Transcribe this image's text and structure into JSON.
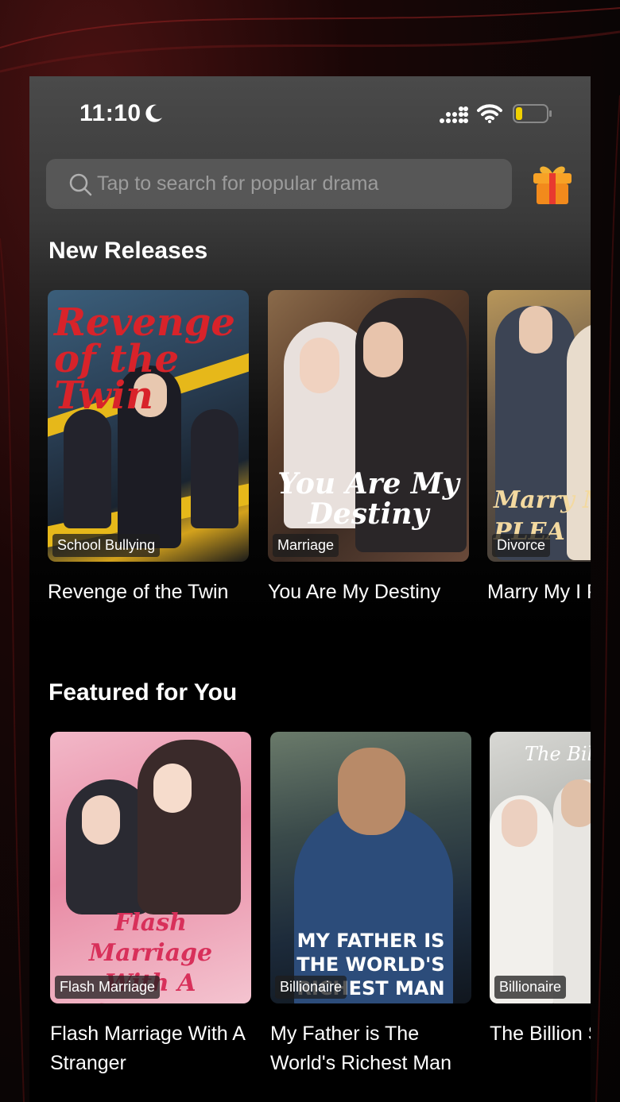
{
  "status": {
    "time": "11:10"
  },
  "search": {
    "placeholder": "Tap to search for popular drama"
  },
  "sections": [
    {
      "title": "New Releases",
      "items": [
        {
          "title": "Revenge of the Twin",
          "tag": "School Bullying",
          "poster_text": "Revenge of the Twin"
        },
        {
          "title": "You Are My Destiny",
          "tag": "Marriage",
          "poster_text": "You Are My Destiny"
        },
        {
          "title": "Marry My I Please!",
          "tag": "Divorce",
          "poster_text": "Marry M PLEA"
        }
      ]
    },
    {
      "title": "Featured for You",
      "items": [
        {
          "title": "Flash Marriage With A Stranger",
          "tag": "Flash Marriage",
          "poster_text": "Flash Marriage With A Stranger"
        },
        {
          "title": "My Father is The World's Richest Man",
          "tag": "Billionaire",
          "poster_text": "MY FATHER IS THE WORLD'S RICHEST MAN"
        },
        {
          "title": "The Billion Security G",
          "tag": "Billionaire",
          "poster_text": "The Billio Secu"
        }
      ]
    }
  ],
  "colors": {
    "accent": "#e8392f",
    "gift": "#f5a023",
    "battery": "#f0d000"
  },
  "icons": [
    "moon-icon",
    "signal-icon",
    "wifi-icon",
    "battery-icon",
    "search-icon",
    "gift-icon"
  ]
}
